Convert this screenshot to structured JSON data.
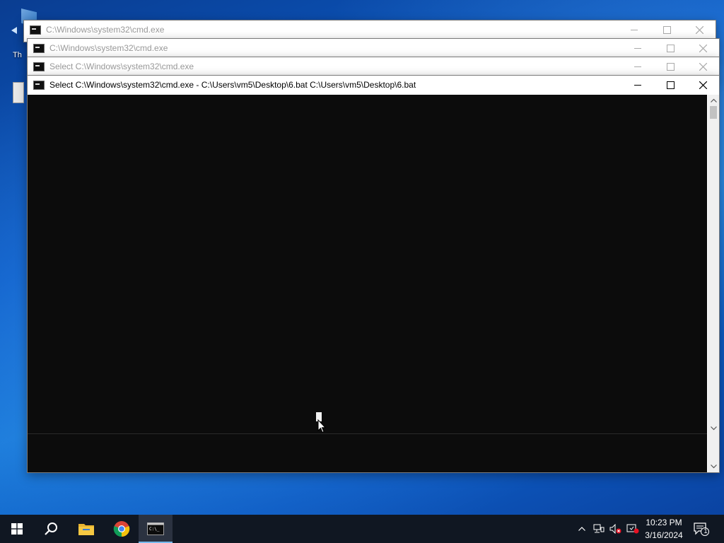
{
  "desktop": {
    "icon_label": "Th"
  },
  "windows": [
    {
      "title": "C:\\Windows\\system32\\cmd.exe"
    },
    {
      "title": "C:\\Windows\\system32\\cmd.exe"
    },
    {
      "title": "Select C:\\Windows\\system32\\cmd.exe"
    },
    {
      "title": "Select C:\\Windows\\system32\\cmd.exe - C:\\Users\\vm5\\Desktop\\6.bat   C:\\Users\\vm5\\Desktop\\6.bat"
    }
  ],
  "taskbar": {
    "start_icon": "windows-logo-icon",
    "search_icon": "search-icon",
    "pinned": [
      "file-explorer-icon",
      "chrome-icon",
      "cmd-icon"
    ],
    "tray": {
      "notification_count": "1",
      "time": "10:23 PM",
      "date": "3/16/2024"
    }
  },
  "colors": {
    "console_bg": "#0c0c0c",
    "taskbar_bg": "#101722",
    "accent": "#76b9ed"
  }
}
